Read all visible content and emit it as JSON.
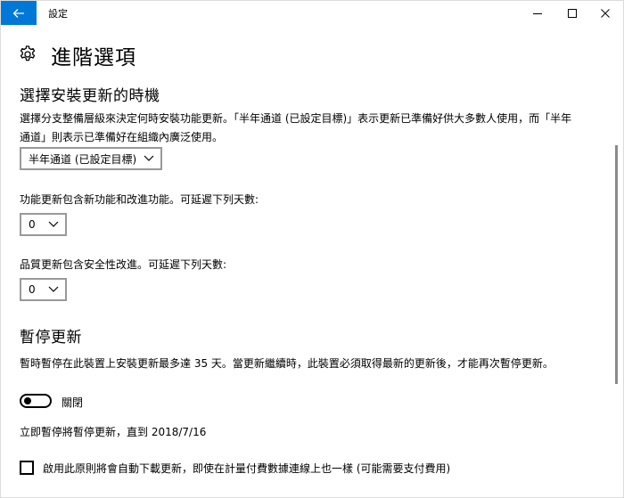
{
  "window": {
    "title": "設定"
  },
  "header": {
    "title": "進階選項"
  },
  "choose_section": {
    "title": "選擇安裝更新的時機",
    "description_line1": "選擇分支整備層級來決定何時安裝功能更新。「半年通道 (已設定目標)」表示更新已準備好供大多數人使用，而「半年",
    "description_line2": "通道」則表示已準備好在組織內廣泛使用。",
    "channel_selected": "半年通道 (已設定目標)",
    "feature_label": "功能更新包含新功能和改進功能。可延遲下列天數:",
    "feature_days": "0",
    "quality_label": "品質更新包含安全性改進。可延遲下列天數:",
    "quality_days": "0"
  },
  "pause_section": {
    "title": "暫停更新",
    "description": "暫時暫停在此裝置上安裝更新最多達 35 天。當更新繼續時，此裝置必須取得最新的更新後，才能再次暫停更新。",
    "toggle_state": "關閉",
    "pause_until_text": "立即暫停將暫停更新，直到 2018/7/16",
    "metered_checkbox_label": "啟用此原則將會自動下載更新，即使在計量付費數據連線上也一樣 (可能需要支付費用)"
  },
  "colors": {
    "accent": "#0078d7"
  },
  "icons": {
    "back": "back-arrow-icon",
    "minimize": "minimize-icon",
    "maximize": "maximize-icon",
    "close": "close-icon",
    "settings": "gear-icon",
    "dropdown": "chevron-down-icon"
  }
}
